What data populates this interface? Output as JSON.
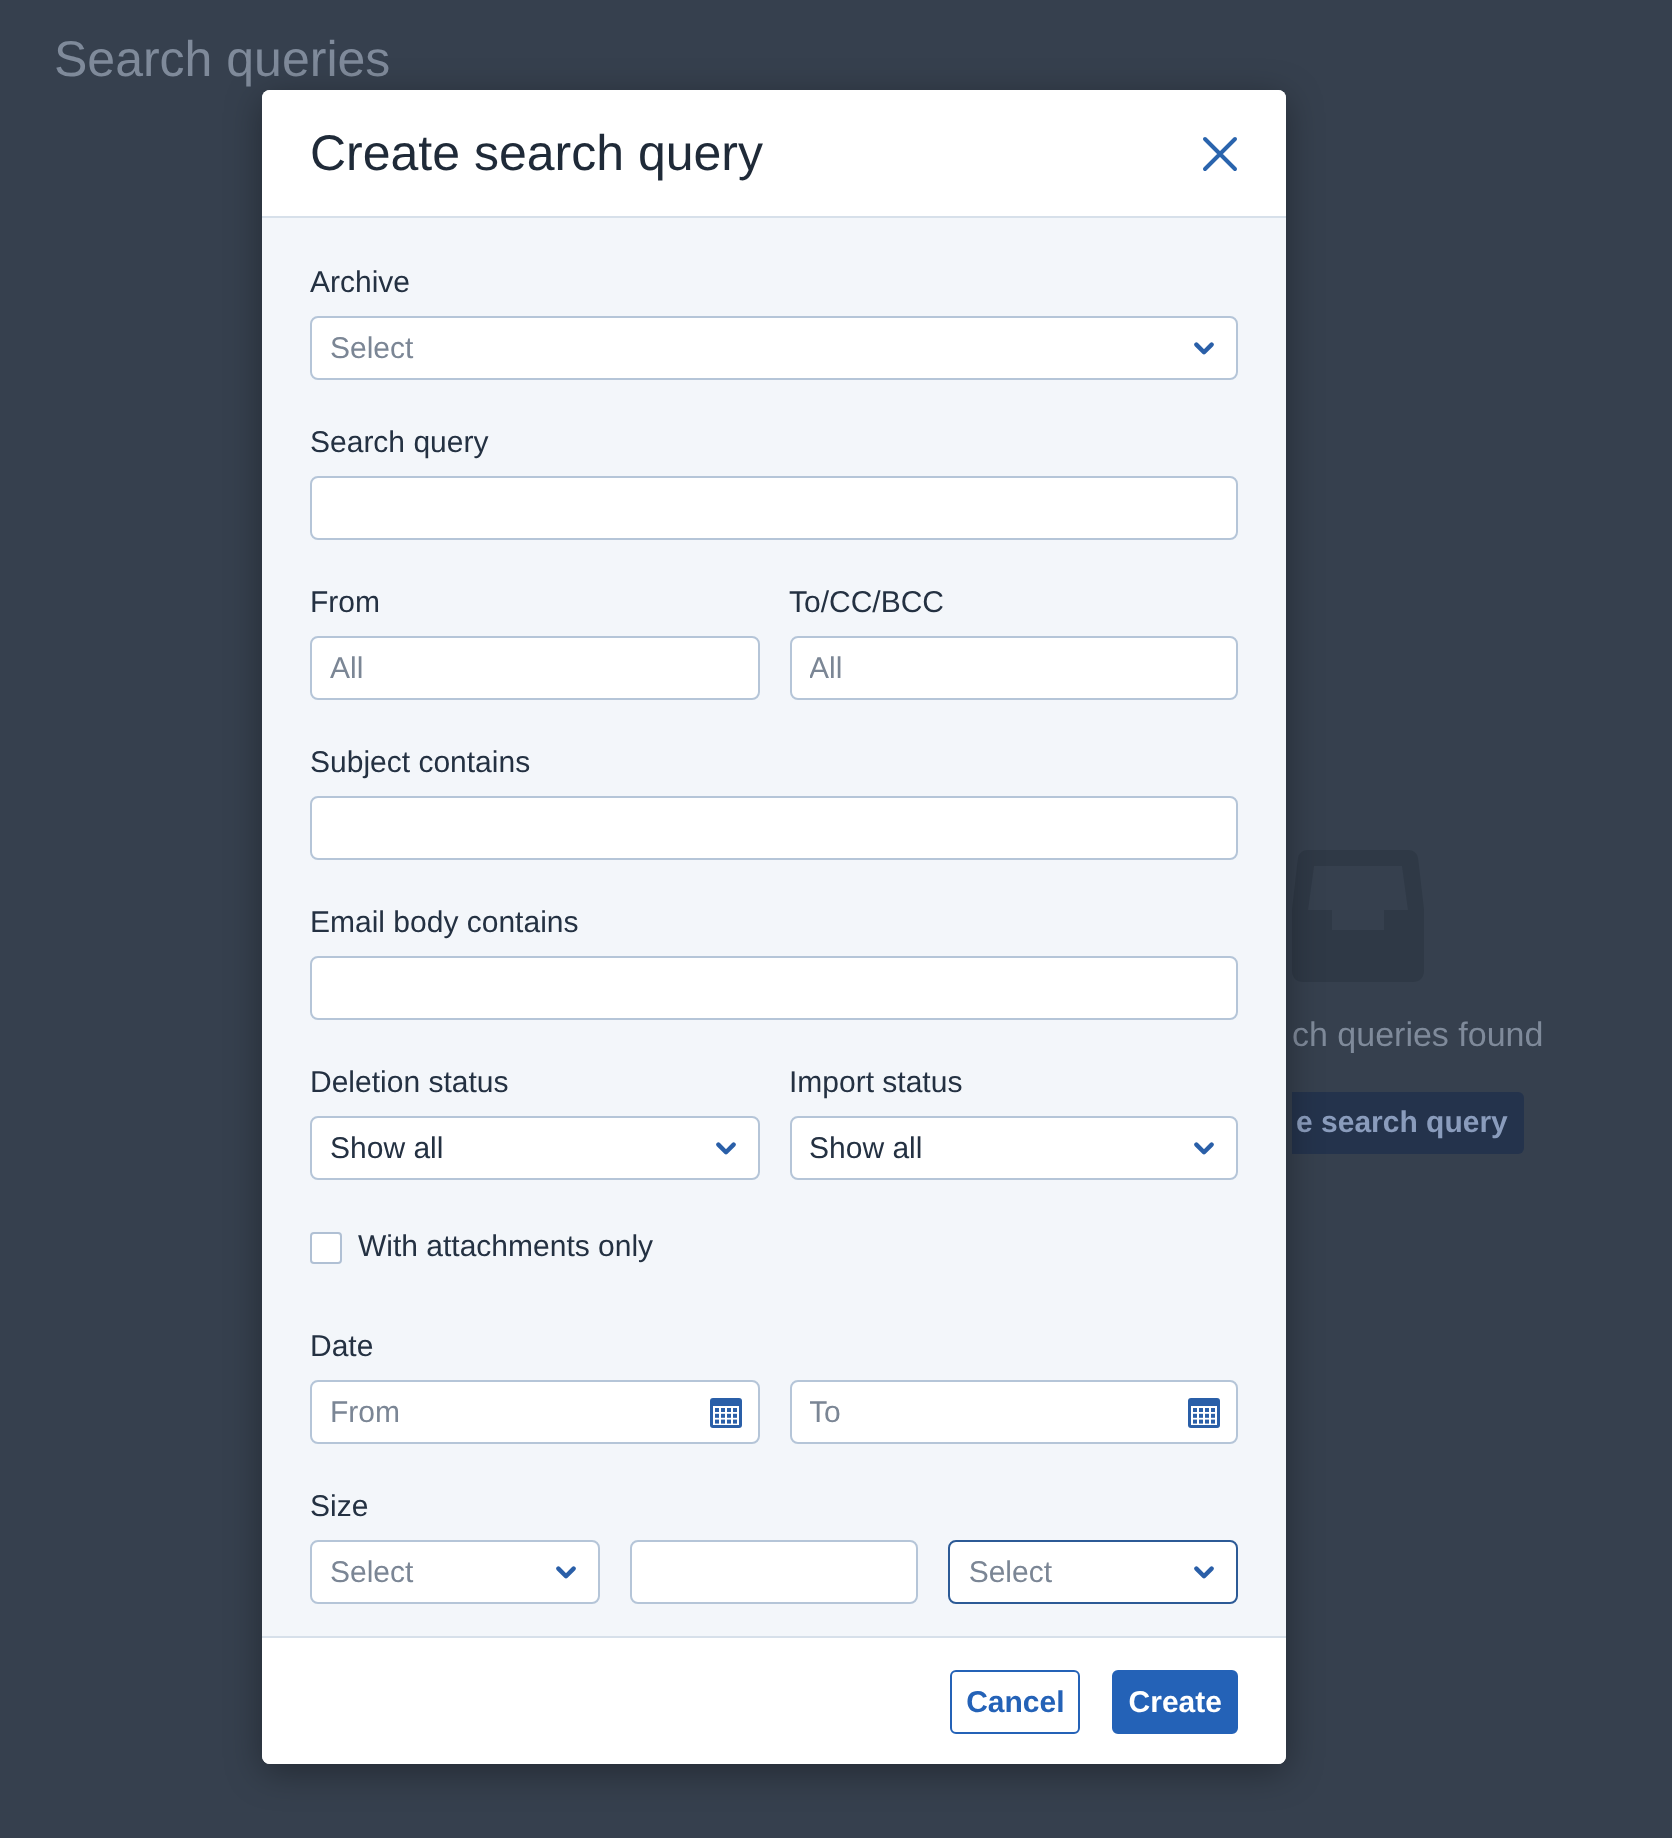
{
  "page": {
    "title": "Search queries",
    "empty_state": {
      "message": "ch queries found",
      "button": "e search query"
    }
  },
  "dialog": {
    "title": "Create search query",
    "rows": [
      {
        "kind": "fields",
        "fields": [
          {
            "kind": "select",
            "label": "Archive",
            "placeholder": "Select"
          }
        ]
      },
      {
        "kind": "fields",
        "fields": [
          {
            "kind": "text",
            "label": "Search query"
          }
        ]
      },
      {
        "kind": "fields",
        "fields": [
          {
            "kind": "text",
            "label": "From",
            "placeholder": "All"
          },
          {
            "kind": "text",
            "label": "To/CC/BCC",
            "placeholder": "All"
          }
        ]
      },
      {
        "kind": "fields",
        "fields": [
          {
            "kind": "text",
            "label": "Subject contains"
          }
        ]
      },
      {
        "kind": "fields",
        "fields": [
          {
            "kind": "text",
            "label": "Email body contains"
          }
        ]
      },
      {
        "kind": "fields",
        "fields": [
          {
            "kind": "select",
            "label": "Deletion status",
            "value": "Show all"
          },
          {
            "kind": "select",
            "label": "Import status",
            "value": "Show all"
          }
        ]
      },
      {
        "kind": "checkbox",
        "label": "With attachments only",
        "checked": false
      },
      {
        "kind": "group",
        "label": "Date",
        "fields": [
          {
            "kind": "date",
            "placeholder": "From"
          },
          {
            "kind": "date",
            "placeholder": "To"
          }
        ]
      },
      {
        "kind": "group",
        "label": "Size",
        "fields": [
          {
            "kind": "select",
            "placeholder": "Select",
            "focused": false
          },
          {
            "kind": "text",
            "focused": false
          },
          {
            "kind": "select",
            "placeholder": "Select",
            "focused": true
          }
        ]
      }
    ],
    "buttons": [
      {
        "kind": "secondary",
        "label": "Cancel"
      },
      {
        "kind": "primary",
        "label": "Create"
      }
    ]
  }
}
